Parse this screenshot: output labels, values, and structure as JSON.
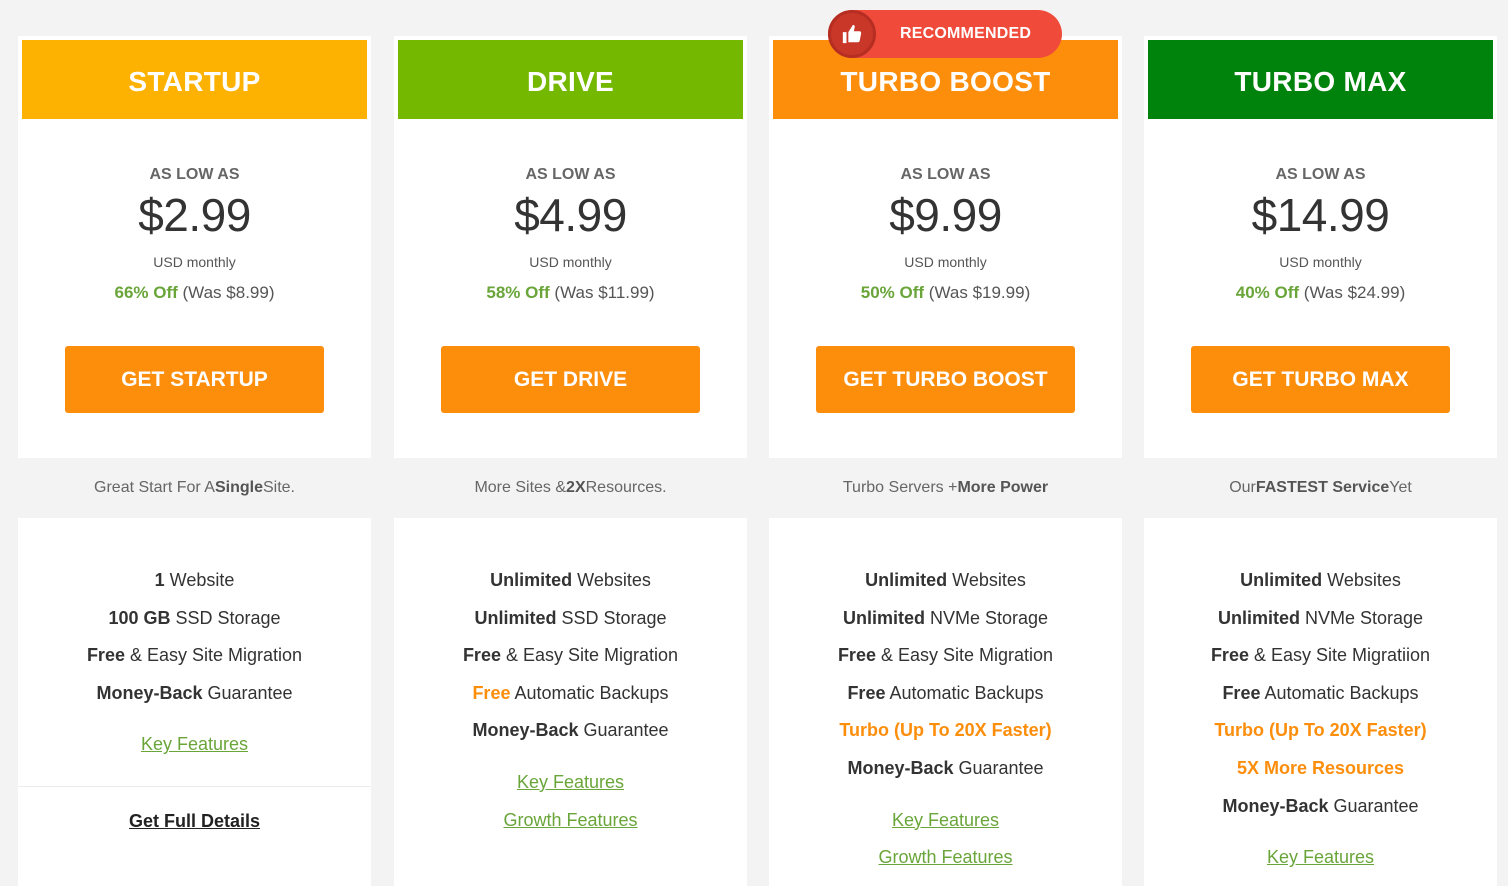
{
  "badge": {
    "label": "RECOMMENDED",
    "icon": "thumbs-up-icon",
    "color": "#f04b3a"
  },
  "plans": [
    {
      "name": "STARTUP",
      "header_color": "#fdb100",
      "as_low_as": "AS LOW AS",
      "price": "$2.99",
      "unit": "USD monthly",
      "discount": "66% Off",
      "was_prefix": "(Was ",
      "was_price": "$8.99",
      "was_suffix": ")",
      "cta": "GET STARTUP",
      "tagline": {
        "pre": "Great Start For A ",
        "bold": "Single",
        "post": " Site."
      },
      "features": [
        {
          "b": "1",
          "t": " Website"
        },
        {
          "b": "100 GB",
          "t": " SSD Storage"
        },
        {
          "b": "Free",
          "t": " & Easy Site Migration"
        },
        {
          "b": "Money-Back",
          "t": " Guarantee"
        }
      ],
      "links": [
        "Key Features"
      ],
      "full_details": "Get Full Details"
    },
    {
      "name": "DRIVE",
      "header_color": "#74b900",
      "as_low_as": "AS LOW AS",
      "price": "$4.99",
      "unit": "USD monthly",
      "discount": "58% Off",
      "was_prefix": "(Was ",
      "was_price": "$11.99",
      "was_suffix": ")",
      "cta": "GET DRIVE",
      "tagline": {
        "pre": "More Sites & ",
        "bold": "2X",
        "post": " Resources."
      },
      "features": [
        {
          "b": "Unlimited",
          "t": " Websites"
        },
        {
          "b": "Unlimited",
          "t": " SSD Storage"
        },
        {
          "b": "Free",
          "t": " & Easy Site Migration"
        },
        {
          "o": "Free",
          "t": " Automatic Backups"
        },
        {
          "b": "Money-Back",
          "t": " Guarantee"
        }
      ],
      "links": [
        "Key Features",
        "Growth Features"
      ]
    },
    {
      "name": "TURBO BOOST",
      "header_color": "#fd8e0c",
      "as_low_as": "AS LOW AS",
      "price": "$9.99",
      "unit": "USD monthly",
      "discount": "50% Off",
      "was_prefix": "(Was ",
      "was_price": "$19.99",
      "was_suffix": ")",
      "cta": "GET TURBO BOOST",
      "tagline": {
        "pre": "Turbo Servers + ",
        "bold": "More Power",
        "post": ""
      },
      "features": [
        {
          "b": "Unlimited",
          "t": " Websites"
        },
        {
          "b": "Unlimited",
          "t": " NVMe Storage"
        },
        {
          "b": "Free",
          "t": " & Easy Site Migration"
        },
        {
          "b": "Free",
          "t": " Automatic Backups"
        },
        {
          "full": "Turbo (Up To 20X Faster)"
        },
        {
          "b": "Money-Back",
          "t": " Guarantee"
        }
      ],
      "links": [
        "Key Features",
        "Growth Features"
      ]
    },
    {
      "name": "TURBO MAX",
      "header_color": "#00830d",
      "as_low_as": "AS LOW AS",
      "price": "$14.99",
      "unit": "USD monthly",
      "discount": "40% Off",
      "was_prefix": "(Was ",
      "was_price": "$24.99",
      "was_suffix": ")",
      "cta": "GET TURBO MAX",
      "tagline": {
        "pre": "Our ",
        "bold": "FASTEST Service",
        "post": " Yet"
      },
      "features": [
        {
          "b": "Unlimited",
          "t": " Websites"
        },
        {
          "b": "Unlimited",
          "t": " NVMe Storage"
        },
        {
          "b": "Free",
          "t": " & Easy Site Migratiion"
        },
        {
          "b": "Free",
          "t": " Automatic Backups"
        },
        {
          "full": "Turbo (Up To 20X Faster)"
        },
        {
          "full": "5X More Resources"
        },
        {
          "b": "Money-Back",
          "t": " Guarantee"
        }
      ],
      "links": [
        "Key Features"
      ]
    }
  ]
}
